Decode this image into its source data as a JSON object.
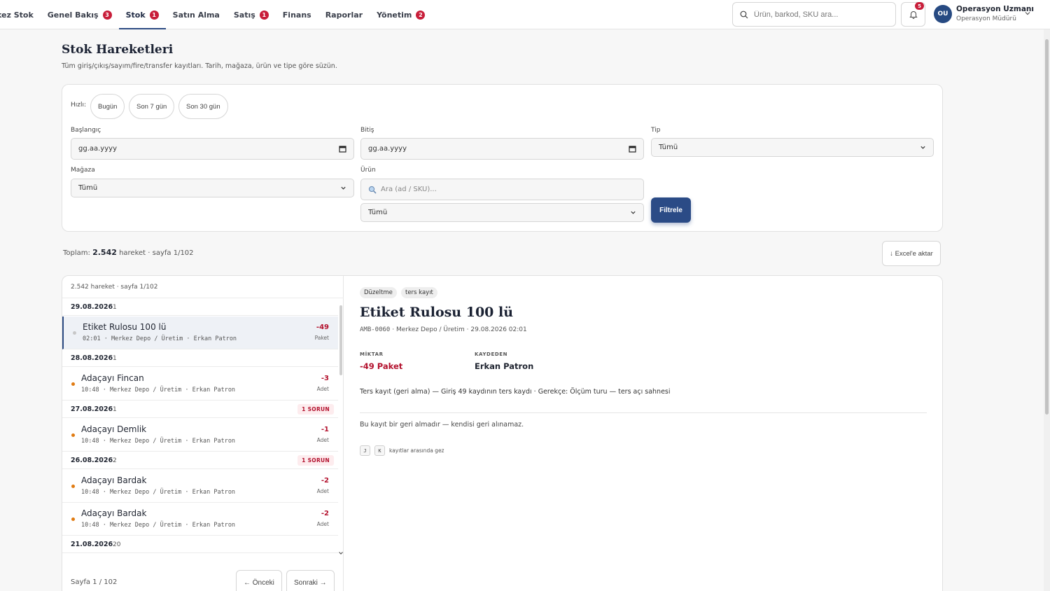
{
  "nav": [
    {
      "label": "kez Stok",
      "badge": null,
      "active": false
    },
    {
      "label": "Genel Bakış",
      "badge": "3",
      "active": false
    },
    {
      "label": "Stok",
      "badge": "1",
      "active": true
    },
    {
      "label": "Satın Alma",
      "badge": null,
      "active": false
    },
    {
      "label": "Satış",
      "badge": "1",
      "active": false
    },
    {
      "label": "Finans",
      "badge": null,
      "active": false
    },
    {
      "label": "Raporlar",
      "badge": null,
      "active": false
    },
    {
      "label": "Yönetim",
      "badge": "2",
      "active": false
    }
  ],
  "search": {
    "placeholder": "Ürün, barkod, SKU ara..."
  },
  "notifications": {
    "count": "5"
  },
  "user": {
    "initials": "OU",
    "name": "Operasyon Uzmanı",
    "role": "Operasyon Müdürü"
  },
  "page": {
    "title": "Stok Hareketleri",
    "subtitle": "Tüm giriş/çıkış/sayım/fire/transfer kayıtları. Tarih, mağaza, ürün ve tipe göre süzün."
  },
  "filters": {
    "quick_label": "Hızlı:",
    "quick": [
      "Bugün",
      "Son 7 gün",
      "Son 30 gün"
    ],
    "start_label": "Başlangıç",
    "start_value": "gg.aa.yyyy",
    "end_label": "Bitiş",
    "end_value": "gg.aa.yyyy",
    "type_label": "Tip",
    "type_value": "Tümü",
    "store_label": "Mağaza",
    "store_value": "Tümü",
    "product_label": "Ürün",
    "product_placeholder": "Ara (ad / SKU)...",
    "product_select_value": "Tümü",
    "filter_button": "Filtrele"
  },
  "summary": {
    "prefix": "Toplam:",
    "count": "2.542",
    "suffix": "hareket · sayfa 1/102"
  },
  "export_button": "↓ Excel'e aktar",
  "list": {
    "header": "2.542 hareket · sayfa 1/102",
    "groups": [
      {
        "date": "29.08.2026",
        "count": "1",
        "issue": null,
        "items": [
          {
            "name": "Etiket Rulosu 100 lü",
            "meta": "02:01 · Merkez Depo / Üretim · Erkan Patron",
            "qty": "-49",
            "unit": "Paket",
            "dot": "#c7c7c7",
            "selected": true
          }
        ]
      },
      {
        "date": "28.08.2026",
        "count": "1",
        "issue": null,
        "items": [
          {
            "name": "Adaçayı Fincan",
            "meta": "10:48 · Merkez Depo / Üretim · Erkan Patron",
            "qty": "-3",
            "unit": "Adet",
            "dot": "#e07b12",
            "selected": false
          }
        ]
      },
      {
        "date": "27.08.2026",
        "count": "1",
        "issue": "1 SORUN",
        "items": [
          {
            "name": "Adaçayı Demlik",
            "meta": "10:48 · Merkez Depo / Üretim · Erkan Patron",
            "qty": "-1",
            "unit": "Adet",
            "dot": "#e07b12",
            "selected": false
          }
        ]
      },
      {
        "date": "26.08.2026",
        "count": "2",
        "issue": "1 SORUN",
        "items": [
          {
            "name": "Adaçayı Bardak",
            "meta": "10:48 · Merkez Depo / Üretim · Erkan Patron",
            "qty": "-2",
            "unit": "Adet",
            "dot": "#e07b12",
            "selected": false
          },
          {
            "name": "Adaçayı Bardak",
            "meta": "10:48 · Merkez Depo / Üretim · Erkan Patron",
            "qty": "-2",
            "unit": "Adet",
            "dot": "#e07b12",
            "selected": false
          }
        ]
      },
      {
        "date": "21.08.2026",
        "count": "20",
        "issue": null,
        "items": []
      }
    ]
  },
  "pager": {
    "info": "Sayfa 1 / 102",
    "prev": "← Önceki",
    "next": "Sonraki →"
  },
  "detail": {
    "tags": [
      "Düzeltme",
      "ters kayıt"
    ],
    "title": "Etiket Rulosu 100 lü",
    "sku": "AMB-0060",
    "meta_rest": " · Merkez Depo / Üretim · 29.08.2026 02:01",
    "qty_label": "MİKTAR",
    "qty_value": "-49 Paket",
    "by_label": "KAYDEDEN",
    "by_value": "Erkan Patron",
    "description": "Ters kayıt (geri alma) — Giriş 49 kaydının ters kaydı · Gerekçe: Ölçüm turu — ters açı sahnesi",
    "note": "Bu kayıt bir geri almadır — kendisi geri alınamaz.",
    "kbd_prev": "J",
    "kbd_next": "K",
    "kbd_hint": "kayıtlar arasında gez"
  },
  "colors": {
    "accent": "#2b4b86",
    "danger": "#b3122e",
    "warning_dot": "#e07b12"
  }
}
